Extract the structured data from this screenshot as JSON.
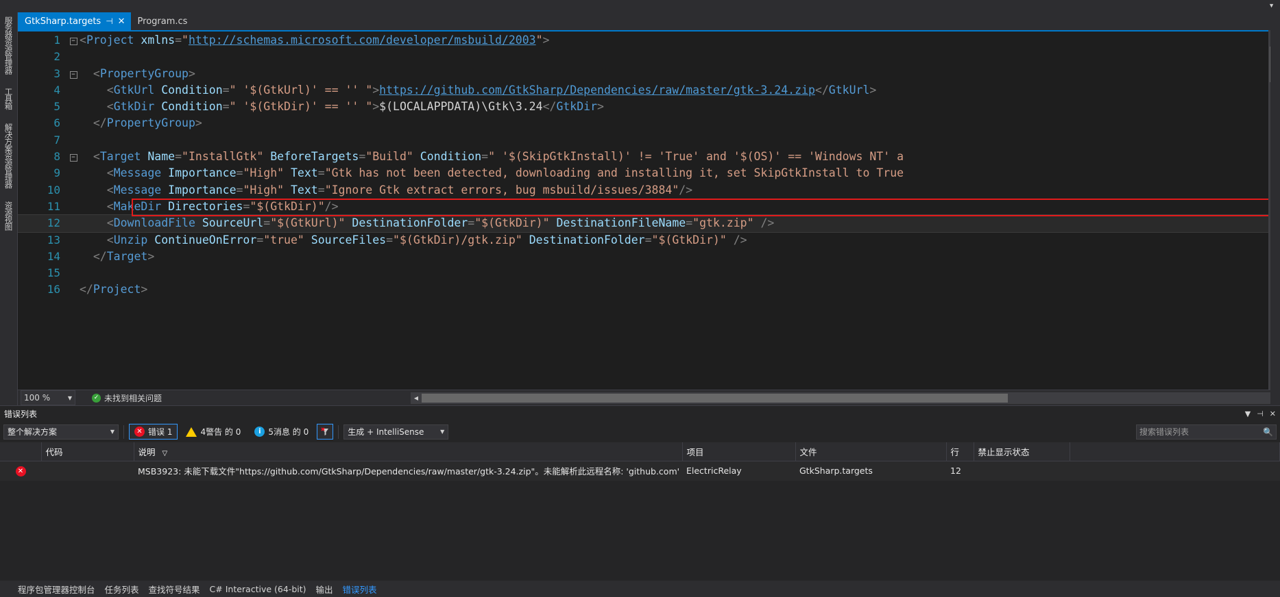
{
  "sidebar": {
    "items": [
      {
        "label": "服务器资源管理器",
        "name": "server-explorer"
      },
      {
        "label": "工具箱",
        "name": "toolbox"
      },
      {
        "label": "解决方案资源管理器",
        "name": "solution-explorer"
      },
      {
        "label": "资源视图",
        "name": "resource-view"
      }
    ]
  },
  "tabs": {
    "active": {
      "label": "GtkSharp.targets",
      "pin": "⊣",
      "close": "✕"
    },
    "inactive": {
      "label": "Program.cs"
    }
  },
  "editor": {
    "lines": [
      {
        "num": "1",
        "fold": "minus",
        "tokens": [
          {
            "t": "br",
            "v": "<"
          },
          {
            "t": "tg",
            "v": "Project"
          },
          {
            "t": "pl",
            "v": " "
          },
          {
            "t": "pn",
            "v": "xmlns"
          },
          {
            "t": "br",
            "v": "="
          },
          {
            "t": "st",
            "v": "\""
          },
          {
            "t": "lk",
            "v": "http://schemas.microsoft.com/developer/msbuild/2003"
          },
          {
            "t": "st",
            "v": "\""
          },
          {
            "t": "br",
            "v": ">"
          }
        ]
      },
      {
        "num": "2",
        "fold": "",
        "tokens": []
      },
      {
        "num": "3",
        "fold": "minus",
        "tokens": [
          {
            "t": "pl",
            "v": "  "
          },
          {
            "t": "br",
            "v": "<"
          },
          {
            "t": "tg",
            "v": "PropertyGroup"
          },
          {
            "t": "br",
            "v": ">"
          }
        ]
      },
      {
        "num": "4",
        "fold": "",
        "tokens": [
          {
            "t": "pl",
            "v": "    "
          },
          {
            "t": "br",
            "v": "<"
          },
          {
            "t": "tg",
            "v": "GtkUrl"
          },
          {
            "t": "pl",
            "v": " "
          },
          {
            "t": "pn",
            "v": "Condition"
          },
          {
            "t": "br",
            "v": "="
          },
          {
            "t": "st",
            "v": "\" '$(GtkUrl)' == '' \""
          },
          {
            "t": "br",
            "v": ">"
          },
          {
            "t": "lk",
            "v": "https://github.com/GtkSharp/Dependencies/raw/master/gtk-3.24.zip"
          },
          {
            "t": "br",
            "v": "</"
          },
          {
            "t": "tg",
            "v": "GtkUrl"
          },
          {
            "t": "br",
            "v": ">"
          }
        ]
      },
      {
        "num": "5",
        "fold": "",
        "tokens": [
          {
            "t": "pl",
            "v": "    "
          },
          {
            "t": "br",
            "v": "<"
          },
          {
            "t": "tg",
            "v": "GtkDir"
          },
          {
            "t": "pl",
            "v": " "
          },
          {
            "t": "pn",
            "v": "Condition"
          },
          {
            "t": "br",
            "v": "="
          },
          {
            "t": "st",
            "v": "\" '$(GtkDir)' == '' \""
          },
          {
            "t": "br",
            "v": ">"
          },
          {
            "t": "pl",
            "v": "$(LOCALAPPDATA)\\Gtk\\3.24"
          },
          {
            "t": "br",
            "v": "</"
          },
          {
            "t": "tg",
            "v": "GtkDir"
          },
          {
            "t": "br",
            "v": ">"
          }
        ]
      },
      {
        "num": "6",
        "fold": "",
        "tokens": [
          {
            "t": "pl",
            "v": "  "
          },
          {
            "t": "br",
            "v": "</"
          },
          {
            "t": "tg",
            "v": "PropertyGroup"
          },
          {
            "t": "br",
            "v": ">"
          }
        ]
      },
      {
        "num": "7",
        "fold": "",
        "tokens": []
      },
      {
        "num": "8",
        "fold": "minus",
        "tokens": [
          {
            "t": "pl",
            "v": "  "
          },
          {
            "t": "br",
            "v": "<"
          },
          {
            "t": "tg",
            "v": "Target"
          },
          {
            "t": "pl",
            "v": " "
          },
          {
            "t": "pn",
            "v": "Name"
          },
          {
            "t": "br",
            "v": "="
          },
          {
            "t": "st",
            "v": "\"InstallGtk\""
          },
          {
            "t": "pl",
            "v": " "
          },
          {
            "t": "pn",
            "v": "BeforeTargets"
          },
          {
            "t": "br",
            "v": "="
          },
          {
            "t": "st",
            "v": "\"Build\""
          },
          {
            "t": "pl",
            "v": " "
          },
          {
            "t": "pn",
            "v": "Condition"
          },
          {
            "t": "br",
            "v": "="
          },
          {
            "t": "st",
            "v": "\" '$(SkipGtkInstall)' != 'True' and '$(OS)' == 'Windows NT' a"
          }
        ]
      },
      {
        "num": "9",
        "fold": "",
        "highlight": "red",
        "tokens": [
          {
            "t": "pl",
            "v": "    "
          },
          {
            "t": "br",
            "v": "<"
          },
          {
            "t": "tg",
            "v": "Message"
          },
          {
            "t": "pl",
            "v": " "
          },
          {
            "t": "pn",
            "v": "Importance"
          },
          {
            "t": "br",
            "v": "="
          },
          {
            "t": "st",
            "v": "\"High\""
          },
          {
            "t": "pl",
            "v": " "
          },
          {
            "t": "pn",
            "v": "Text"
          },
          {
            "t": "br",
            "v": "="
          },
          {
            "t": "st",
            "v": "\"Gtk has not been detected, downloading and installing it, set SkipGtkInstall to True"
          }
        ]
      },
      {
        "num": "10",
        "fold": "",
        "tokens": [
          {
            "t": "pl",
            "v": "    "
          },
          {
            "t": "br",
            "v": "<"
          },
          {
            "t": "tg",
            "v": "Message"
          },
          {
            "t": "pl",
            "v": " "
          },
          {
            "t": "pn",
            "v": "Importance"
          },
          {
            "t": "br",
            "v": "="
          },
          {
            "t": "st",
            "v": "\"High\""
          },
          {
            "t": "pl",
            "v": " "
          },
          {
            "t": "pn",
            "v": "Text"
          },
          {
            "t": "br",
            "v": "="
          },
          {
            "t": "st",
            "v": "\"Ignore Gtk extract errors, bug msbuild/issues/3884\""
          },
          {
            "t": "br",
            "v": "/>"
          }
        ]
      },
      {
        "num": "11",
        "fold": "",
        "tokens": [
          {
            "t": "pl",
            "v": "    "
          },
          {
            "t": "br",
            "v": "<"
          },
          {
            "t": "tg",
            "v": "MakeDir"
          },
          {
            "t": "pl",
            "v": " "
          },
          {
            "t": "pn",
            "v": "Directories"
          },
          {
            "t": "br",
            "v": "="
          },
          {
            "t": "st",
            "v": "\"$(GtkDir)\""
          },
          {
            "t": "br",
            "v": "/>"
          }
        ]
      },
      {
        "num": "12",
        "fold": "",
        "highlight": "row",
        "tokens": [
          {
            "t": "pl",
            "v": "    "
          },
          {
            "t": "br",
            "v": "<"
          },
          {
            "t": "tg",
            "v": "DownloadFile"
          },
          {
            "t": "pl",
            "v": " "
          },
          {
            "t": "pn",
            "v": "SourceUrl"
          },
          {
            "t": "br",
            "v": "="
          },
          {
            "t": "st",
            "v": "\"$(GtkUrl)\""
          },
          {
            "t": "pl",
            "v": " "
          },
          {
            "t": "pn",
            "v": "DestinationFolder"
          },
          {
            "t": "br",
            "v": "="
          },
          {
            "t": "st",
            "v": "\"$(GtkDir)\""
          },
          {
            "t": "pl",
            "v": " "
          },
          {
            "t": "pn",
            "v": "DestinationFileName"
          },
          {
            "t": "br",
            "v": "="
          },
          {
            "t": "st",
            "v": "\"gtk.zip\""
          },
          {
            "t": "pl",
            "v": " "
          },
          {
            "t": "br",
            "v": "/>"
          }
        ]
      },
      {
        "num": "13",
        "fold": "",
        "tokens": [
          {
            "t": "pl",
            "v": "    "
          },
          {
            "t": "br",
            "v": "<"
          },
          {
            "t": "tg",
            "v": "Unzip"
          },
          {
            "t": "pl",
            "v": " "
          },
          {
            "t": "pn",
            "v": "ContinueOnError"
          },
          {
            "t": "br",
            "v": "="
          },
          {
            "t": "st",
            "v": "\"true\""
          },
          {
            "t": "pl",
            "v": " "
          },
          {
            "t": "pn",
            "v": "SourceFiles"
          },
          {
            "t": "br",
            "v": "="
          },
          {
            "t": "st",
            "v": "\"$(GtkDir)/gtk.zip\""
          },
          {
            "t": "pl",
            "v": " "
          },
          {
            "t": "pn",
            "v": "DestinationFolder"
          },
          {
            "t": "br",
            "v": "="
          },
          {
            "t": "st",
            "v": "\"$(GtkDir)\""
          },
          {
            "t": "pl",
            "v": " "
          },
          {
            "t": "br",
            "v": "/>"
          }
        ]
      },
      {
        "num": "14",
        "fold": "",
        "tokens": [
          {
            "t": "pl",
            "v": "  "
          },
          {
            "t": "br",
            "v": "</"
          },
          {
            "t": "tg",
            "v": "Target"
          },
          {
            "t": "br",
            "v": ">"
          }
        ]
      },
      {
        "num": "15",
        "fold": "",
        "tokens": []
      },
      {
        "num": "16",
        "fold": "",
        "tokens": [
          {
            "t": "br",
            "v": "</"
          },
          {
            "t": "tg",
            "v": "Project"
          },
          {
            "t": "br",
            "v": ">"
          }
        ]
      }
    ]
  },
  "status": {
    "zoom": "100 %",
    "zoom_caret": "▼",
    "issues": "未找到相关问题",
    "ok_mark": "✓",
    "scroll_left": "◀",
    "scroll_right": "▶"
  },
  "errorlist": {
    "title": "错误列表",
    "window_caret": "▼",
    "window_pin": "⊣",
    "window_close": "✕",
    "scope": "整个解决方案",
    "scope_caret": "▼",
    "severity": [
      {
        "name": "errors",
        "label": "错误 1",
        "icon": "error-icon",
        "selected": true
      },
      {
        "name": "warnings",
        "label": "4警告 的 0",
        "icon": "warning-icon",
        "selected": false
      },
      {
        "name": "messages",
        "label": "5消息 的 0",
        "icon": "info-icon",
        "selected": false
      }
    ],
    "filter_icon": "clear-filter-icon",
    "build_filter": "生成 + IntelliSense",
    "build_filter_caret": "▼",
    "search_placeholder": "搜索错误列表",
    "search_icon": "🔍",
    "columns": [
      "",
      "代码",
      "说明",
      "项目",
      "文件",
      "行",
      "禁止显示状态",
      ""
    ],
    "sort_indicator": "▽",
    "rows": [
      {
        "severity_icon": "error-icon",
        "code": "",
        "description": "MSB3923: 未能下载文件\"https://github.com/GtkSharp/Dependencies/raw/master/gtk-3.24.zip\"。未能解析此远程名称: 'github.com'",
        "project": "ElectricRelay",
        "file": "GtkSharp.targets",
        "line": "12",
        "suppression": ""
      }
    ]
  },
  "bottom_tabs": [
    {
      "label": "程序包管理器控制台",
      "active": false
    },
    {
      "label": "任务列表",
      "active": false
    },
    {
      "label": "查找符号结果",
      "active": false
    },
    {
      "label": "C# Interactive (64-bit)",
      "active": false
    },
    {
      "label": "输出",
      "active": false
    },
    {
      "label": "错误列表",
      "active": true
    }
  ],
  "colors": {
    "accent": "#007acc",
    "error": "#e81123",
    "warning": "#ffcc00",
    "info": "#1ba1e2",
    "ok": "#39a03a",
    "highlight_box": "#e21b1b"
  }
}
